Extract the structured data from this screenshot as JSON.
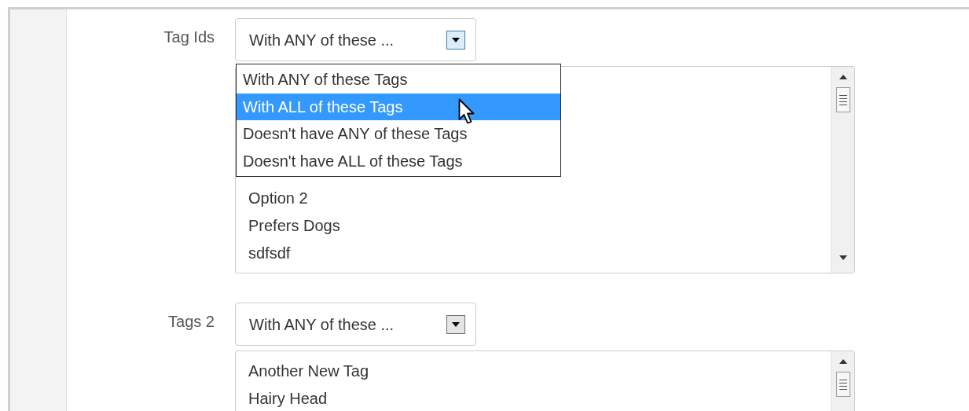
{
  "fields": [
    {
      "label": "Tag Ids",
      "select": {
        "value": "With ANY of these ...",
        "focused": true
      },
      "dropdown": [
        {
          "label": "With ANY of these Tags",
          "selected": false
        },
        {
          "label": "With ALL of these Tags",
          "selected": true
        },
        {
          "label": "Doesn't have ANY of these Tags",
          "selected": false
        },
        {
          "label": "Doesn't have ALL of these Tags",
          "selected": false
        }
      ],
      "listbox": [
        "Option 2",
        "Prefers Dogs",
        "sdfsdf"
      ]
    },
    {
      "label": "Tags 2",
      "select": {
        "value": "With ANY of these ...",
        "focused": false
      },
      "listbox": [
        "Another New Tag",
        "Hairy Head"
      ]
    }
  ]
}
